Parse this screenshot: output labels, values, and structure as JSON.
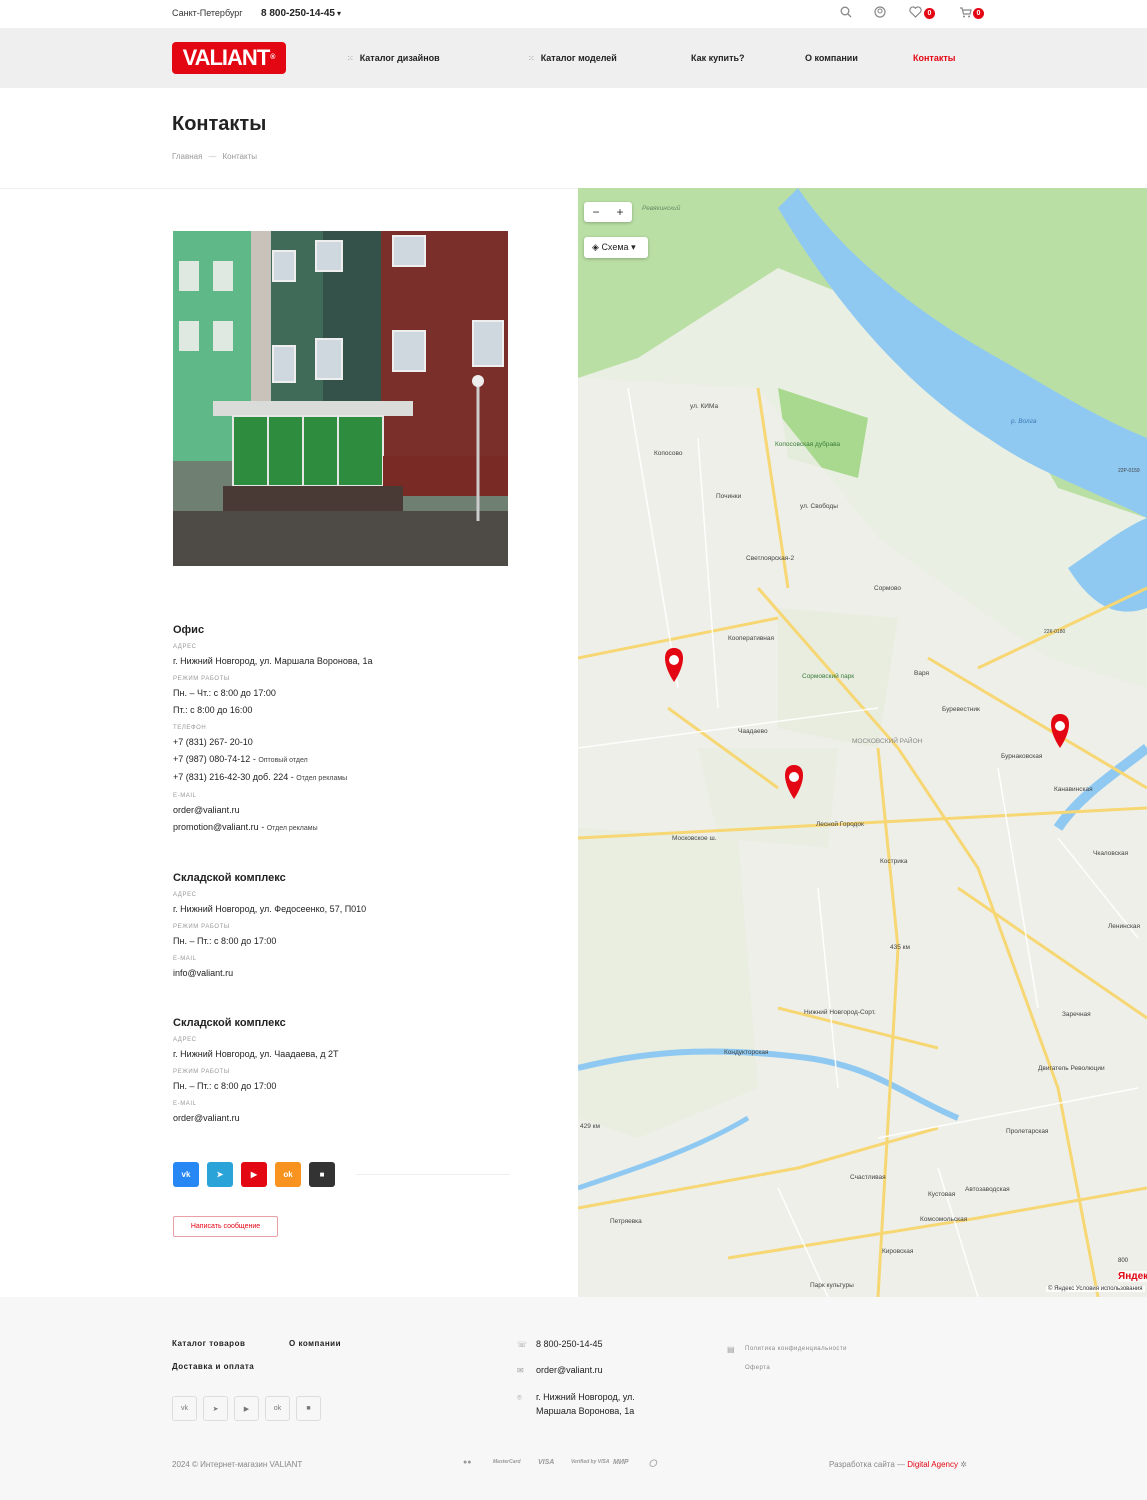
{
  "topbar": {
    "city": "Санкт-Петербург",
    "phone": "8 800-250-14-45",
    "favorites_count": "0",
    "cart_count": "0"
  },
  "header": {
    "logo": "VALIANT",
    "nav": [
      {
        "label": "Каталог дизайнов"
      },
      {
        "label": "Каталог моделей"
      },
      {
        "label": "Как купить?"
      },
      {
        "label": "О компании"
      },
      {
        "label": "Контакты"
      }
    ]
  },
  "page": {
    "title": "Контакты",
    "breadcrumb": [
      "Главная",
      "Контакты"
    ]
  },
  "office": {
    "title": "Офис",
    "address_label": "Адрес",
    "address": "г. Нижний Новгород, ул. Маршала Воронова, 1а",
    "hours_label": "Режим работы",
    "hours": [
      "Пн. – Чт.: с 8:00 до 17:00",
      "Пт.: с 8:00 до 16:00"
    ],
    "phone_label": "Телефон",
    "phones": [
      {
        "number": "+7 (831) 267- 20-10",
        "note": ""
      },
      {
        "number": "+7 (987) 080-74-12",
        "note": "Оптовый отдел"
      },
      {
        "number": "+7 (831) 216-42-30 доб. 224",
        "note": "Отдел рекламы"
      }
    ],
    "email_label": "E-mail",
    "emails": [
      {
        "address": "order@valiant.ru",
        "note": ""
      },
      {
        "address": "promotion@valiant.ru",
        "note": "Отдел рекламы"
      }
    ]
  },
  "warehouse1": {
    "title": "Складской комплекс",
    "address_label": "Адрес",
    "address": "г. Нижний Новгород, ул. Федосеенко, 57, П010",
    "hours_label": "Режим работы",
    "hours": "Пн. – Пт.: с 8:00 до 17:00",
    "email_label": "E-mail",
    "email": "info@valiant.ru"
  },
  "warehouse2": {
    "title": "Складской комплекс",
    "address_label": "Адрес",
    "address": "г. Нижний Новгород, ул. Чаадаева, д 2Т",
    "hours_label": "Режим работы",
    "hours": "Пн. – Пт.: с 8:00 до 17:00",
    "email_label": "E-mail",
    "email": "order@valiant.ru"
  },
  "socials": [
    {
      "icon": "vk-icon",
      "text": "vk",
      "color": "#2787f5"
    },
    {
      "icon": "telegram-icon",
      "text": "➤",
      "color": "#2aa3d8"
    },
    {
      "icon": "youtube-icon",
      "text": "▶",
      "color": "#e30613"
    },
    {
      "icon": "odnoklassniki-icon",
      "text": "ok",
      "color": "#f7931e"
    },
    {
      "icon": "rutube-icon",
      "text": "■",
      "color": "#333333"
    }
  ],
  "message_button": "Написать сообщение",
  "map": {
    "layer_label": "Схема",
    "labels": [
      "Ревякинский",
      "ул. КИМа",
      "Копосово",
      "Копосовская дубрава",
      "Починки",
      "ул. Свободы",
      "Светлоярская-2",
      "Сормово",
      "Кооперативная",
      "Сормовский парк",
      "Варя",
      "Буревестник",
      "Бурнаковская",
      "Канавинская",
      "Чаадаево",
      "МОСКОВСКИЙ РАЙОН",
      "Лесной Городок",
      "Московское ш.",
      "Кострика",
      "435 км",
      "Нижний Новгород-Сорт.",
      "Кондукторская",
      "Заречная",
      "Двигатель Революции",
      "Ленинская",
      "Чкаловская",
      "Пролетарская",
      "429 км",
      "Счастливая",
      "Кустовая",
      "Автозаводская",
      "Комсомольская",
      "Кировская",
      "Петряевка",
      "Парк культуры",
      "р. Волга",
      "22Р-0159",
      "22К-0180"
    ],
    "copyright": "© Яндекс Условия использования",
    "brand": "Яндекс",
    "scale": "800"
  },
  "footer": {
    "links": [
      "Каталог товаров",
      "О компании",
      "Доставка и оплата"
    ],
    "phone": "8 800-250-14-45",
    "email": "order@valiant.ru",
    "address_line1": "г. Нижний Новгород, ул.",
    "address_line2": "Маршала Воронова, 1а",
    "policy": "Политика конфиденциальности",
    "offer": "Оферта",
    "copyright": "2024 © Интернет-магазин VALIANT",
    "payments": [
      "MasterCard",
      "VISA",
      "Verified by VISA",
      "МИР"
    ],
    "dev_text": "Разработка сайта —",
    "dev_agency": "Digital Agency"
  }
}
